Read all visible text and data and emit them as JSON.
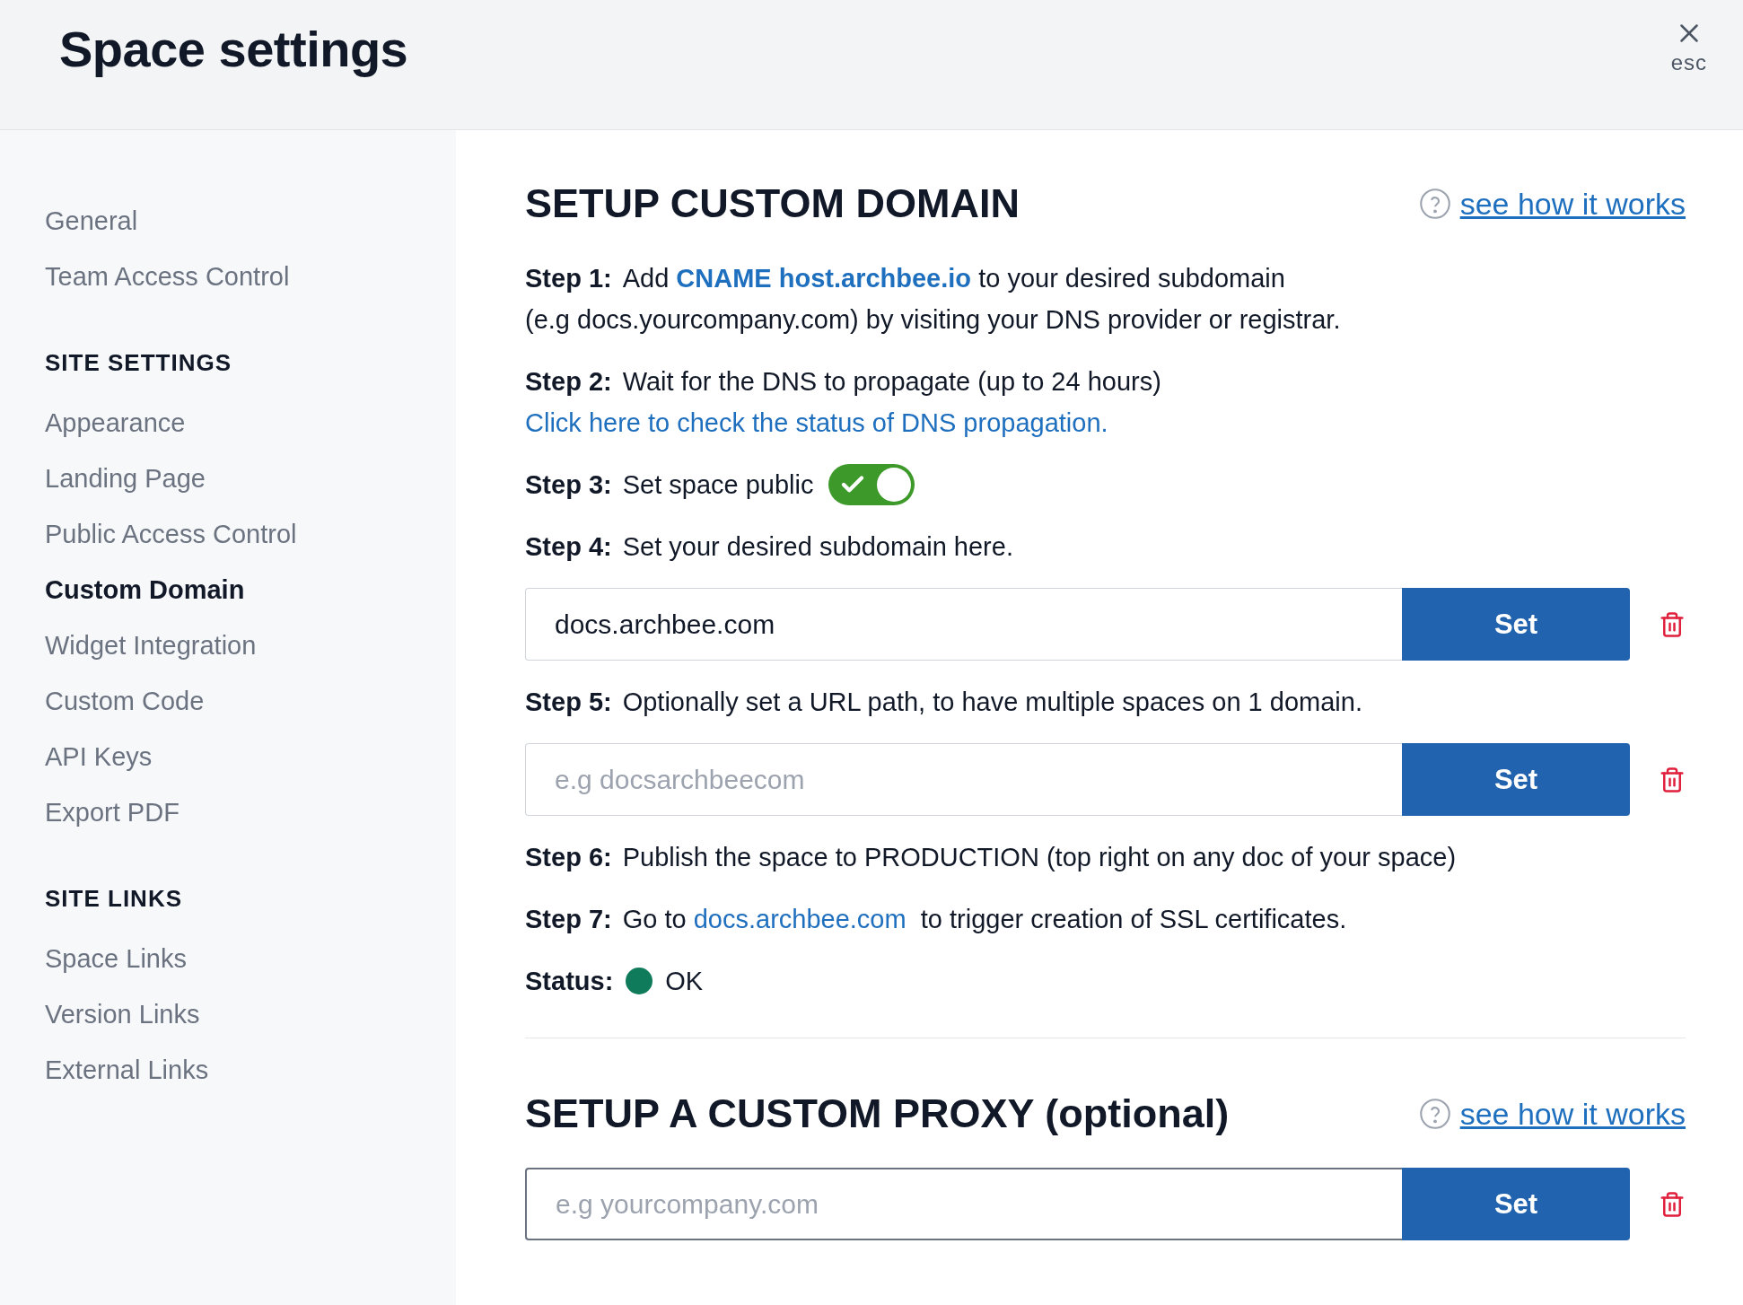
{
  "header": {
    "title": "Space settings",
    "close_hint": "esc"
  },
  "sidebar": {
    "groups": [
      {
        "items": [
          {
            "label": "General",
            "selected": false
          },
          {
            "label": "Team Access Control",
            "selected": false
          }
        ]
      },
      {
        "heading": "SITE SETTINGS",
        "items": [
          {
            "label": "Appearance",
            "selected": false
          },
          {
            "label": "Landing Page",
            "selected": false
          },
          {
            "label": "Public Access Control",
            "selected": false
          },
          {
            "label": "Custom Domain",
            "selected": true
          },
          {
            "label": "Widget Integration",
            "selected": false
          },
          {
            "label": "Custom Code",
            "selected": false
          },
          {
            "label": "API Keys",
            "selected": false
          },
          {
            "label": "Export PDF",
            "selected": false
          }
        ]
      },
      {
        "heading": "SITE LINKS",
        "items": [
          {
            "label": "Space Links",
            "selected": false
          },
          {
            "label": "Version Links",
            "selected": false
          },
          {
            "label": "External Links",
            "selected": false
          }
        ]
      }
    ]
  },
  "sections": [
    {
      "title": "SETUP CUSTOM DOMAIN",
      "help_link": "see how it works",
      "rows": [
        {
          "kind": "step",
          "label": "Step 1:",
          "lines": [
            [
              {
                "kind": "text",
                "text": "Add "
              },
              {
                "kind": "highlight",
                "text": "CNAME host.archbee.io"
              },
              {
                "kind": "text",
                "text": " to your desired subdomain"
              }
            ],
            [
              {
                "kind": "text",
                "text": "(e.g docs.yourcompany.com) by visiting your DNS provider or registrar."
              }
            ]
          ]
        },
        {
          "kind": "step",
          "label": "Step 2:",
          "lines": [
            [
              {
                "kind": "text",
                "text": "Wait for the DNS to propagate (up to 24 hours)"
              }
            ],
            [
              {
                "kind": "link",
                "text": "Click here to check the status of DNS propagation."
              }
            ]
          ]
        },
        {
          "kind": "step",
          "label": "Step 3:",
          "lines": [
            [
              {
                "kind": "text",
                "text": "Set space public"
              }
            ]
          ],
          "toggle": {
            "on": true
          }
        },
        {
          "kind": "step",
          "label": "Step 4:",
          "lines": [
            [
              {
                "kind": "text",
                "text": "Set your desired subdomain here."
              }
            ]
          ]
        },
        {
          "kind": "field",
          "value": "docs.archbee.com",
          "button": "Set",
          "focused": false
        },
        {
          "kind": "step",
          "label": "Step 5:",
          "lines": [
            [
              {
                "kind": "text",
                "text": "Optionally set a URL path, to have multiple spaces on 1 domain."
              }
            ]
          ]
        },
        {
          "kind": "field",
          "placeholder": "e.g docsarchbeecom",
          "button": "Set",
          "focused": false
        },
        {
          "kind": "step",
          "label": "Step 6:",
          "lines": [
            [
              {
                "kind": "text",
                "text": "Publish the space to PRODUCTION (top right on any doc of your space)"
              }
            ]
          ]
        },
        {
          "kind": "step",
          "label": "Step 7:",
          "lines": [
            [
              {
                "kind": "text",
                "text": "Go to "
              },
              {
                "kind": "link",
                "text": "docs.archbee.com"
              },
              {
                "kind": "text",
                "text": "  to trigger creation of SSL certificates."
              }
            ]
          ]
        },
        {
          "kind": "status",
          "label": "Status:",
          "color": "#0f7b5a",
          "text": "OK"
        }
      ]
    },
    {
      "title": "SETUP A CUSTOM PROXY (optional)",
      "help_link": "see how it works",
      "rows": [
        {
          "kind": "field",
          "placeholder": "e.g yourcompany.com",
          "button": "Set",
          "focused": true
        }
      ]
    }
  ]
}
